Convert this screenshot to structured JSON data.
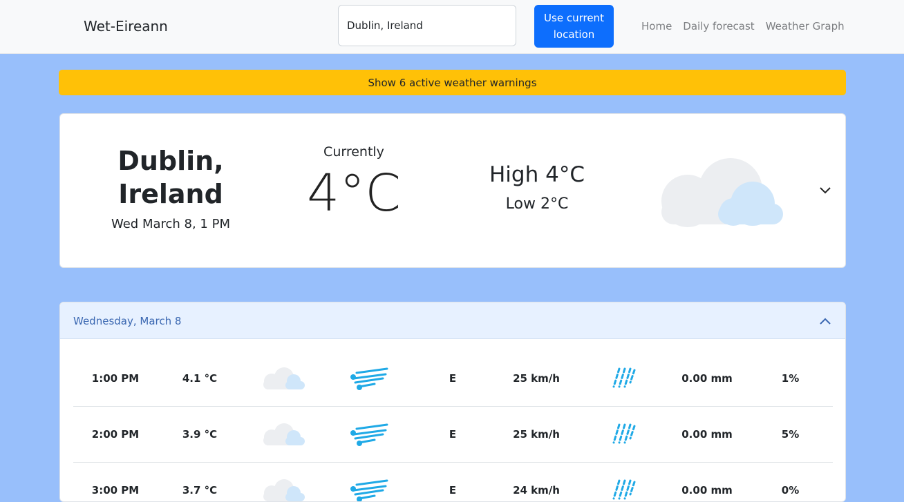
{
  "navbar": {
    "brand": "Wet-Eireann",
    "search_value": "Dublin, Ireland",
    "location_button": "Use current location",
    "links": [
      "Home",
      "Daily forecast",
      "Weather Graph"
    ]
  },
  "warning": {
    "label": "Show 6 active weather warnings"
  },
  "current": {
    "city_line1": "Dublin,",
    "city_line2": "Ireland",
    "datetime": "Wed March 8, 1 PM",
    "currently_label": "Currently",
    "temperature": "4°C",
    "high": "High 4°C",
    "low": "Low 2°C",
    "icon": "cloud-icon"
  },
  "hourly": {
    "day": "Wednesday, March 8",
    "rows": [
      {
        "time": "1:00 PM",
        "temp": "4.1 °C",
        "direction": "E",
        "speed": "25 km/h",
        "rain": "0.00 mm",
        "chance": "1%"
      },
      {
        "time": "2:00 PM",
        "temp": "3.9 °C",
        "direction": "E",
        "speed": "25 km/h",
        "rain": "0.00 mm",
        "chance": "5%"
      },
      {
        "time": "3:00 PM",
        "temp": "3.7 °C",
        "direction": "E",
        "speed": "24 km/h",
        "rain": "0.00 mm",
        "chance": "0%"
      }
    ]
  },
  "colors": {
    "accent": "#0d6efd",
    "warning": "#ffc107",
    "background": "#98bffb",
    "icon_blue": "#1fa9e6"
  }
}
